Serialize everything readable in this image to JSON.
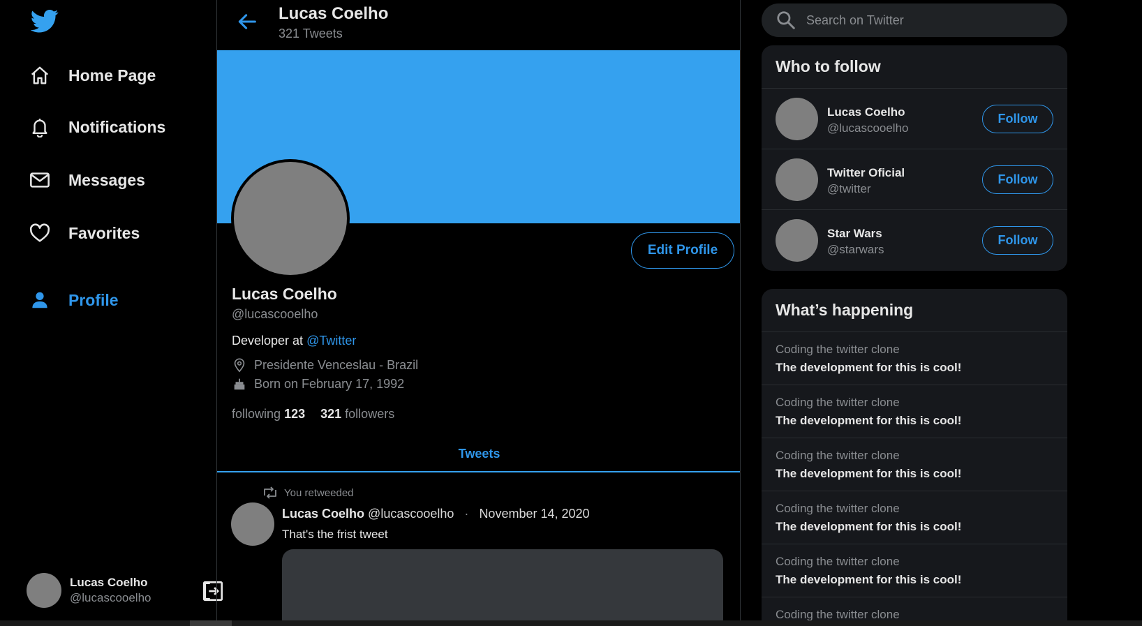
{
  "nav": {
    "logo": "twitter-bird-icon",
    "items": [
      {
        "label": "Home Page",
        "icon": "home-icon",
        "active": false
      },
      {
        "label": "Notifications",
        "icon": "bell-icon",
        "active": false
      },
      {
        "label": "Messages",
        "icon": "mail-icon",
        "active": false
      },
      {
        "label": "Favorites",
        "icon": "heart-icon",
        "active": false
      },
      {
        "label": "Profile",
        "icon": "user-icon",
        "active": true
      }
    ]
  },
  "account": {
    "name": "Lucas Coelho",
    "handle": "@lucascooelho"
  },
  "header": {
    "name": "Lucas Coelho",
    "tweet_count": "321 Tweets"
  },
  "profile": {
    "edit_label": "Edit Profile",
    "name": "Lucas Coelho",
    "handle": "@lucascooelho",
    "bio_prefix": "Developer at ",
    "bio_mention": "@Twitter",
    "location": "Presidente Venceslau - Brazil",
    "birth": "Born on February 17, 1992",
    "following_label": "following",
    "following_count": "123",
    "followers_count": "321",
    "followers_label": "followers"
  },
  "tabs": {
    "tweets": "Tweets"
  },
  "tweet": {
    "retweet_note": "You retweeded",
    "name": "Lucas Coelho",
    "handle": "@lucascooelho",
    "separator": "·",
    "date": "November 14, 2020",
    "text": "That's the frist tweet"
  },
  "search": {
    "placeholder": "Search on Twitter"
  },
  "who_to_follow": {
    "title": "Who to follow",
    "button_label": "Follow",
    "users": [
      {
        "name": "Lucas Coelho",
        "handle": "@lucascooelho"
      },
      {
        "name": "Twitter Oficial",
        "handle": "@twitter"
      },
      {
        "name": "Star Wars",
        "handle": "@starwars"
      }
    ]
  },
  "happening": {
    "title": "What’s happening",
    "items": [
      {
        "topic": "Coding the twitter clone",
        "headline": "The development for this is cool!"
      },
      {
        "topic": "Coding the twitter clone",
        "headline": "The development for this is cool!"
      },
      {
        "topic": "Coding the twitter clone",
        "headline": "The development for this is cool!"
      },
      {
        "topic": "Coding the twitter clone",
        "headline": "The development for this is cool!"
      },
      {
        "topic": "Coding the twitter clone",
        "headline": "The development for this is cool!"
      },
      {
        "topic": "Coding the twitter clone",
        "headline": ""
      }
    ]
  },
  "colors": {
    "accent": "#2f96ea",
    "banner": "#35a1ef",
    "background": "#000000",
    "card": "#16181c"
  }
}
